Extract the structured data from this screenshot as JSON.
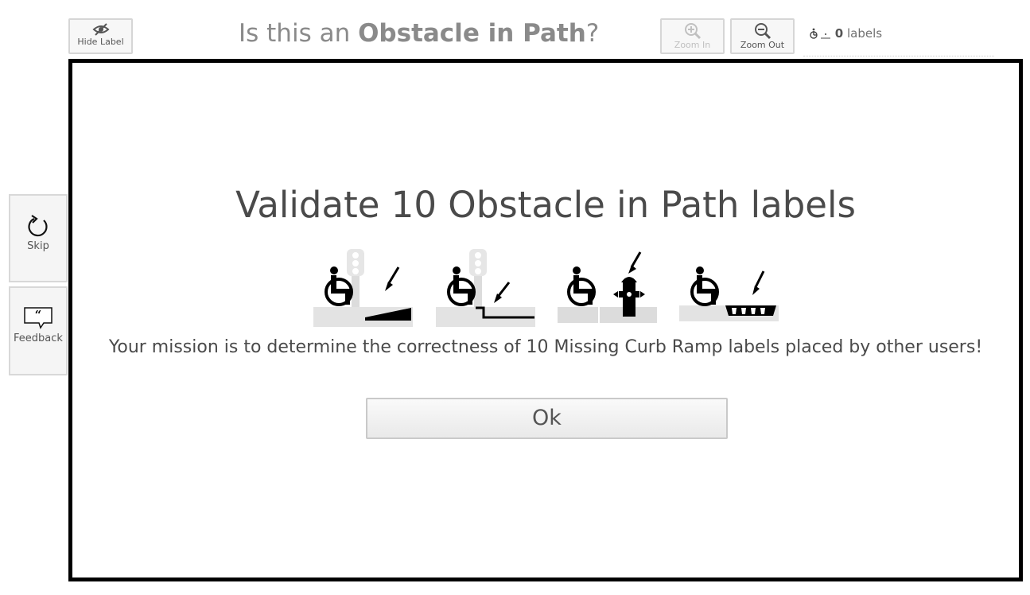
{
  "toolbar": {
    "hide_label": "Hide Label",
    "zoom_in": "Zoom In",
    "zoom_out": "Zoom Out"
  },
  "question": {
    "prefix": "Is this an ",
    "type": "Obstacle in Path",
    "suffix": "?"
  },
  "label_count": {
    "count": "0",
    "unit": "labels"
  },
  "sidebar": {
    "skip": "Skip",
    "feedback": "Feedback"
  },
  "modal": {
    "title": "Validate 10 Obstacle in Path labels",
    "mission": "Your mission is to determine the correctness of 10 Missing Curb Ramp labels placed by other users!",
    "ok": "Ok",
    "example_icons": [
      "wheelchair-ramp-icon",
      "wheelchair-curb-step-icon",
      "wheelchair-fire-hydrant-icon",
      "wheelchair-surface-problem-icon"
    ]
  },
  "colors": {
    "modal_border": "#000000",
    "text": "#4a4a4a",
    "muted": "#8a8a8a"
  }
}
